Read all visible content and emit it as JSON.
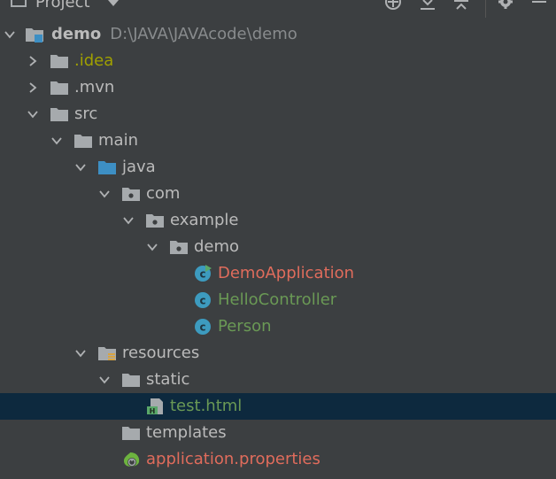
{
  "toolbar": {
    "title": "Project"
  },
  "colors": {
    "background": "#3c3f41",
    "selected_row": "#0d293e",
    "default_text": "#bbbbbb",
    "path_text": "#888b8d",
    "ignored_text": "#a0a000",
    "modified_text": "#6a9955",
    "untracked_text": "#e06c5c",
    "folder_gray": "#a6aaad",
    "folder_blue": "#3d8fc4",
    "class_icon": "#3d9bbf"
  },
  "tree": {
    "root": {
      "label": "demo",
      "path": "D:\\JAVA\\JAVAcode\\demo"
    },
    "idea": {
      "label": ".idea"
    },
    "mvn": {
      "label": ".mvn"
    },
    "src": {
      "label": "src"
    },
    "main": {
      "label": "main"
    },
    "java": {
      "label": "java"
    },
    "com": {
      "label": "com"
    },
    "example": {
      "label": "example"
    },
    "demo_pkg": {
      "label": "demo"
    },
    "demo_application": {
      "label": "DemoApplication"
    },
    "hello_controller": {
      "label": "HelloController"
    },
    "person": {
      "label": "Person"
    },
    "resources": {
      "label": "resources"
    },
    "static": {
      "label": "static"
    },
    "test_html": {
      "label": "test.html"
    },
    "templates": {
      "label": "templates"
    },
    "application_properties": {
      "label": "application.properties"
    }
  }
}
